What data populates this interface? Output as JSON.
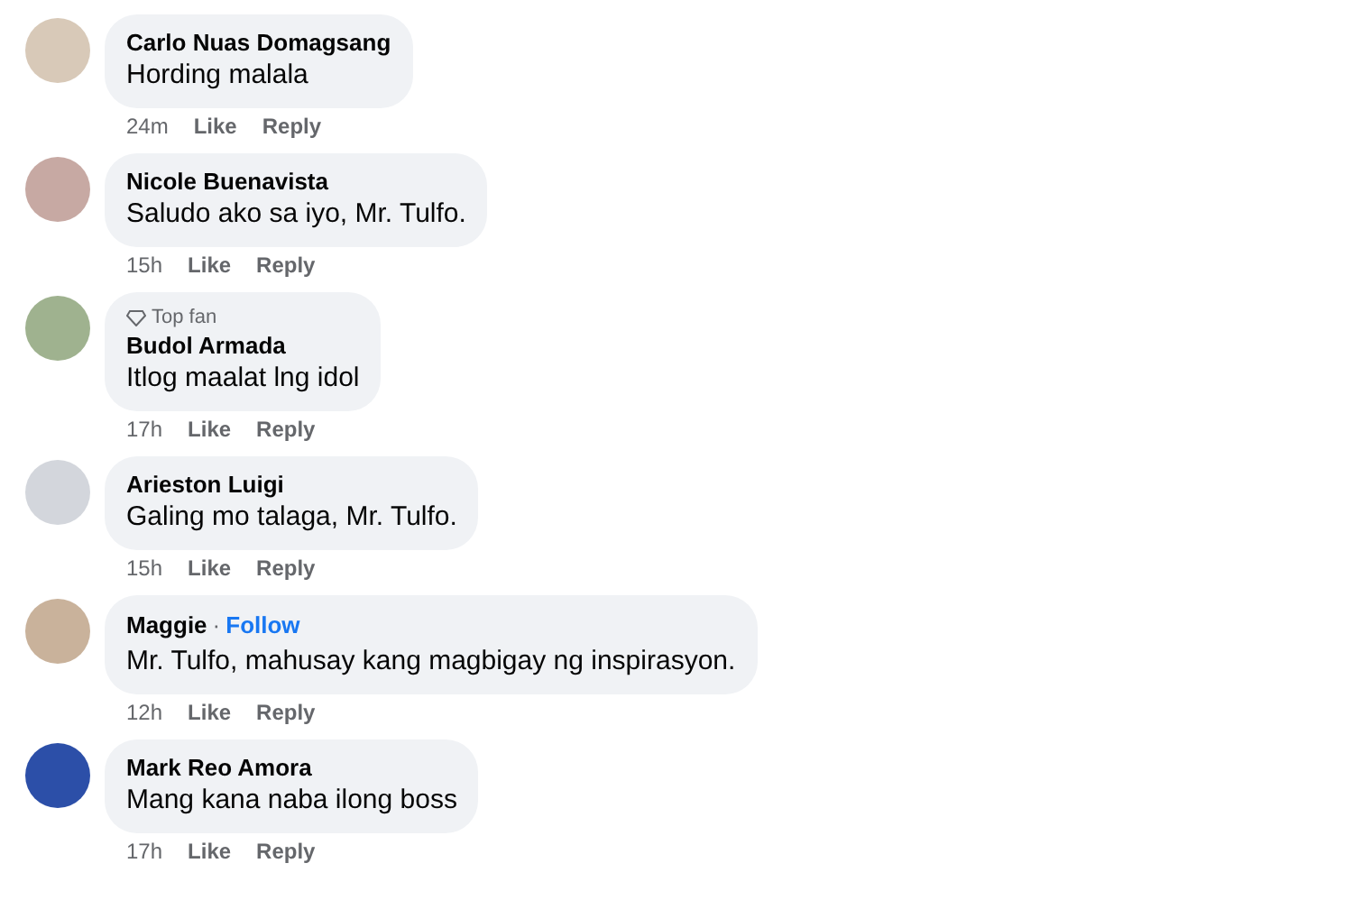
{
  "comments": [
    {
      "author": "Carlo Nuas Domagsang",
      "text": "Hording malala",
      "time": "24m",
      "like": "Like",
      "reply": "Reply"
    },
    {
      "author": "Nicole Buenavista",
      "text": "Saludo ako sa iyo, Mr. Tulfo.",
      "time": "15h",
      "like": "Like",
      "reply": "Reply"
    },
    {
      "badge": "Top fan",
      "author": "Budol Armada",
      "text": "Itlog maalat lng idol",
      "time": "17h",
      "like": "Like",
      "reply": "Reply"
    },
    {
      "author": "Arieston Luigi",
      "text": "Galing mo talaga, Mr. Tulfo.",
      "time": "15h",
      "like": "Like",
      "reply": "Reply"
    },
    {
      "author": "Maggie",
      "separator": "·",
      "follow": "Follow",
      "text": "Mr. Tulfo, mahusay kang magbigay ng inspirasyon.",
      "time": "12h",
      "like": "Like",
      "reply": "Reply"
    },
    {
      "author": "Mark Reo Amora",
      "text": "Mang kana naba ilong boss",
      "time": "17h",
      "like": "Like",
      "reply": "Reply"
    }
  ]
}
